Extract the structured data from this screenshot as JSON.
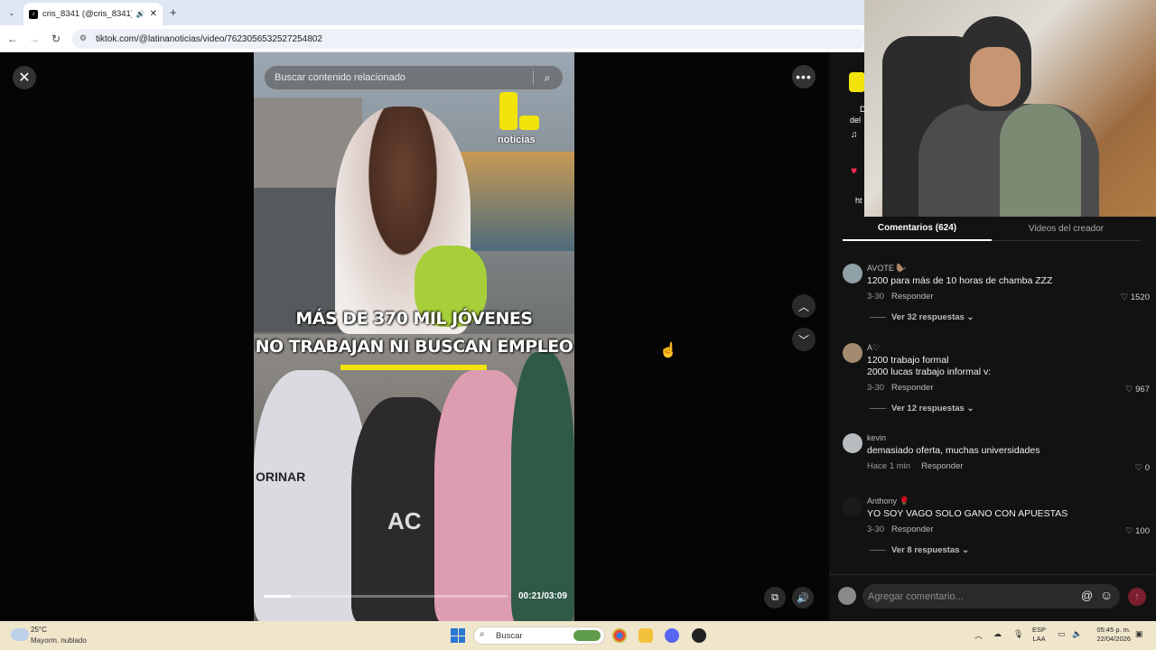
{
  "browser": {
    "tab_title": "cris_8341 (@cris_8341) | Tik",
    "tab_favicon": "tiktok-icon",
    "url": "tiktok.com/@latinanoticias/video/7623056532527254802"
  },
  "video": {
    "search_placeholder": "Buscar contenido relacionado",
    "logo_text": "noticias",
    "headline_line1": "MÁS DE 370 MIL JÓVENES",
    "headline_line2": "NO TRABAJAN NI BUSCAN EMPLEO",
    "time": "00:21/03:09",
    "progress": 0.11,
    "shirt_text": "ORINAR",
    "shirt_text2": "AC"
  },
  "panel": {
    "tab_comments": "Comentarios (624)",
    "tab_videos": "Videos del creador",
    "header_fragment_1": "D",
    "header_fragment_2": "del",
    "header_fragment_3": "ht",
    "comments": [
      {
        "name": "AVOTE 🦫",
        "text": "1200 para más de 10 horas de chamba ZZZ",
        "date": "3-30",
        "reply": "Responder",
        "likes": "1520",
        "replies": "Ver 32 respuestas"
      },
      {
        "name": "A♡",
        "text": "1200 trabajo formal",
        "text2": "2000 lucas trabajo informal v:",
        "date": "3-30",
        "reply": "Responder",
        "likes": "967",
        "replies": "Ver 12 respuestas"
      },
      {
        "name": "kevin",
        "text": "demasiado oferta, muchas universidades",
        "date": "Hace 1 min",
        "reply": "Responder",
        "likes": "0"
      },
      {
        "name": "Anthony 🌹",
        "text": "YO SOY VAGO SOLO GANO CON APUESTAS",
        "date": "3-30",
        "reply": "Responder",
        "likes": "100",
        "replies": "Ver 8 respuestas"
      }
    ],
    "comment_placeholder": "Agregar comentario..."
  },
  "taskbar": {
    "temp": "25°C",
    "weather": "Mayorm. nublado",
    "search": "Buscar",
    "lang1": "ESP",
    "lang2": "LAA",
    "time": "05:45 p. m.",
    "date": "22/04/2026"
  }
}
